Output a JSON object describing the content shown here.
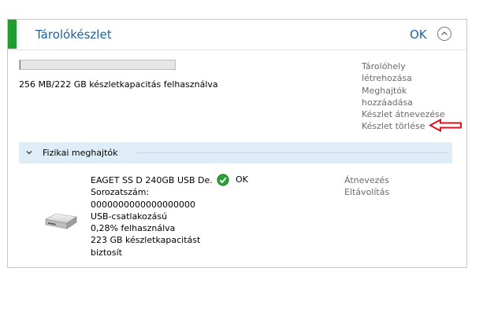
{
  "panel": {
    "title": "Tárolókészlet",
    "status": "OK"
  },
  "capacity": {
    "summary": "256 MB/222 GB készletkapacitás felhasználva",
    "used_fraction": 0.0012
  },
  "actions": [
    "Tárolóhely",
    "létrehozása",
    "Meghajtók",
    "hozzáadása",
    "Készlet átnevezése",
    "Készlet törlése"
  ],
  "section": {
    "title": "Fizikai meghajtók"
  },
  "drive": {
    "name": "EAGET SS D 240GB USB De...",
    "serial_label": "Sorozatszám:",
    "serial": "0000000000000000000",
    "connection": "USB-csatlakozású",
    "usage": "0,28% felhasználva",
    "provides_line1": "223 GB készletkapacitást",
    "provides_line2": "biztosít",
    "status": "OK",
    "actions": [
      "Átnevezés",
      "Eltávolítás"
    ]
  },
  "colors": {
    "accent": "#1e9e30",
    "title": "#1f5f9f",
    "link": "#6b6b6b",
    "section_bg": "#deedf7",
    "annotation_arrow": "#d9141c"
  }
}
